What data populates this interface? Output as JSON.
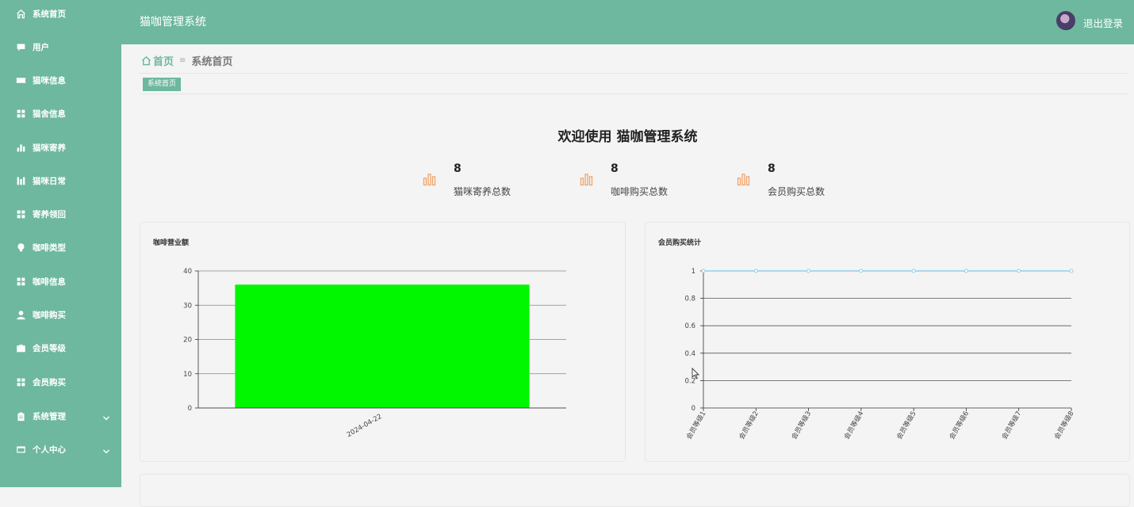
{
  "sidebar": {
    "items": [
      {
        "label": "系统首页",
        "icon": "home-icon"
      },
      {
        "label": "用户",
        "icon": "chat-icon"
      },
      {
        "label": "猫咪信息",
        "icon": "ticket-icon"
      },
      {
        "label": "猫舍信息",
        "icon": "grid-icon"
      },
      {
        "label": "猫咪寄养",
        "icon": "bar-chart-icon"
      },
      {
        "label": "猫咪日常",
        "icon": "column-icon"
      },
      {
        "label": "寄养领回",
        "icon": "grid-icon"
      },
      {
        "label": "咖啡类型",
        "icon": "bulb-icon"
      },
      {
        "label": "咖啡信息",
        "icon": "grid-icon"
      },
      {
        "label": "咖啡购买",
        "icon": "user-icon"
      },
      {
        "label": "会员等级",
        "icon": "briefcase-icon"
      },
      {
        "label": "会员购买",
        "icon": "grid-icon"
      },
      {
        "label": "系统管理",
        "icon": "clipboard-icon",
        "expandable": true
      },
      {
        "label": "个人中心",
        "icon": "card-icon",
        "expandable": true
      }
    ]
  },
  "header": {
    "title": "猫咖管理系统",
    "logout": "退出登录"
  },
  "breadcrumb": {
    "home": "首页",
    "separator": "≡",
    "current": "系统首页"
  },
  "tag": "系统首页",
  "welcome": "欢迎使用 猫咖管理系统",
  "stats": [
    {
      "value": "8",
      "label": "猫咪寄养总数"
    },
    {
      "value": "8",
      "label": "咖啡购买总数"
    },
    {
      "value": "8",
      "label": "会员购买总数"
    }
  ],
  "colors": {
    "brand": "#6db89e",
    "bar": "#00f700",
    "line": "#91cfe8",
    "stat_icon": "#f0a36a"
  },
  "chart_data": [
    {
      "type": "bar",
      "title": "咖啡营业额",
      "categories": [
        "2024-04-22"
      ],
      "values": [
        36
      ],
      "ylim": [
        0,
        40
      ],
      "yticks": [
        0,
        10,
        20,
        30,
        40
      ],
      "grid": true
    },
    {
      "type": "line",
      "title": "会员购买统计",
      "categories": [
        "会员等级1",
        "会员等级2",
        "会员等级3",
        "会员等级4",
        "会员等级5",
        "会员等级6",
        "会员等级7",
        "会员等级8"
      ],
      "values": [
        1,
        1,
        1,
        1,
        1,
        1,
        1,
        1
      ],
      "ylim": [
        0,
        1
      ],
      "yticks": [
        "0",
        "0.2",
        "0.4",
        "0.6",
        "0.8",
        "1"
      ],
      "grid": true
    }
  ]
}
